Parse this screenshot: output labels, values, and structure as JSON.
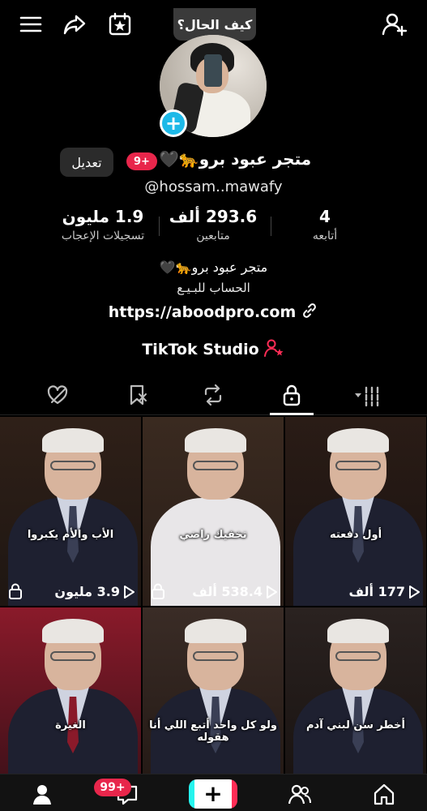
{
  "top_bar": {
    "status_bubble": "كيف الحال؟",
    "icons": [
      "menu-icon",
      "share-icon",
      "calendar-star-icon",
      "add-friend-icon"
    ]
  },
  "profile": {
    "name": "متجر عبود برو🐆🖤",
    "handle": "@hossam..mawafy",
    "edit_label": "تعديل",
    "notification_badge": "9+",
    "stats": {
      "likes": {
        "value": "1.9 مليون",
        "label": "تسجيلات الإعجاب"
      },
      "followers": {
        "value": "293.6 ألف",
        "label": "متابعين"
      },
      "following": {
        "value": "4",
        "label": "أتابعه"
      }
    },
    "bio_line1": "متجر عبود برو🐆🖤",
    "bio_line2": "الحساب للبـيـع",
    "link": "https://aboodpro.com",
    "studio": "TikTok Studio"
  },
  "tabs": {
    "items": [
      "liked-hidden-icon",
      "saved-icon",
      "repost-icon",
      "lock-icon",
      "grid-filter-icon"
    ],
    "active": "lock-icon"
  },
  "videos": [
    {
      "caption": "أول دفعته",
      "views": "177 ألف",
      "locked": false
    },
    {
      "caption": "تخفيك راضي",
      "views": "538.4 ألف",
      "locked": true
    },
    {
      "caption": "الأب والأم يكبروا",
      "views": "3.9 مليون",
      "locked": true
    },
    {
      "caption": "أخطر سن لبني آدم",
      "views": "",
      "locked": false
    },
    {
      "caption": "ولو كل واحد أتبع اللي أنا هقوله",
      "views": "",
      "locked": false
    },
    {
      "caption": "الغيرة",
      "views": "",
      "locked": false
    }
  ],
  "bottom_nav": {
    "inbox_badge": "99+",
    "items": [
      "home-icon",
      "friends-icon",
      "create-icon",
      "inbox-icon",
      "profile-icon"
    ]
  },
  "colors": {
    "badge_red": "#e8264b",
    "plus_blue": "#1db9e8",
    "studio_red": "#fe2c55"
  }
}
